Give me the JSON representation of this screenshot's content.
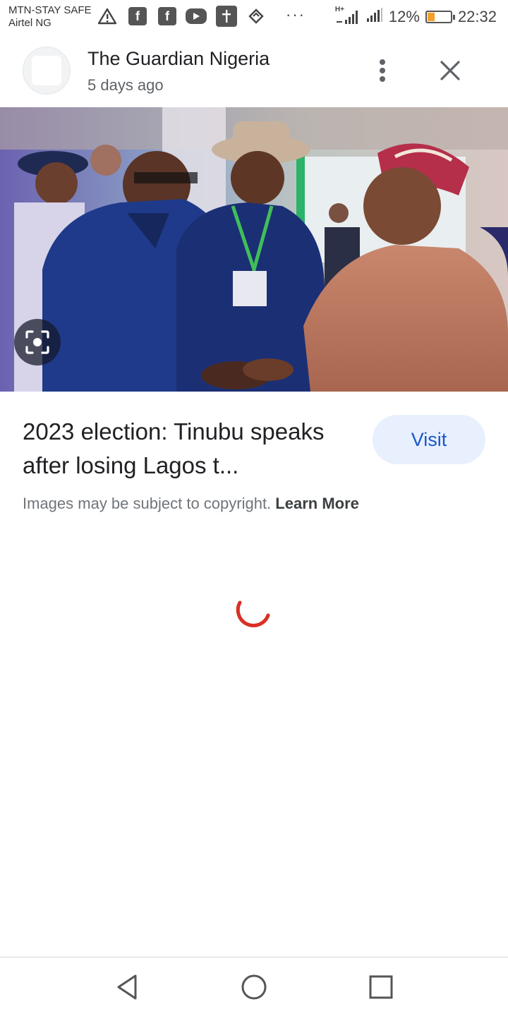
{
  "status_bar": {
    "carrier_1": "MTN-STAY SAFE",
    "carrier_2": "Airtel NG",
    "notification_icons": [
      "warning-icon",
      "facebook-icon",
      "facebook-icon",
      "youtube-icon",
      "cross-app-icon",
      "layers-app-icon"
    ],
    "more_dots": "···",
    "network_label": "H+",
    "battery_percent": "12%",
    "battery_level": 0.12,
    "time": "22:32"
  },
  "header": {
    "site_name": "The Guardian Nigeria",
    "time_ago": "5 days ago"
  },
  "image": {
    "description_icons": [
      "lens-icon"
    ]
  },
  "caption": {
    "title": "2023 election: Tinubu speaks after losing Lagos t...",
    "visit_label": "Visit",
    "copyright_text": "Images may be subject to copyright.",
    "learn_more_label": "Learn More"
  },
  "colors": {
    "visit_bg": "#e8f0fe",
    "visit_text": "#1a56c9",
    "spinner": "#d93025"
  },
  "nav": {
    "icons": [
      "back-icon",
      "home-icon",
      "recents-icon"
    ]
  }
}
